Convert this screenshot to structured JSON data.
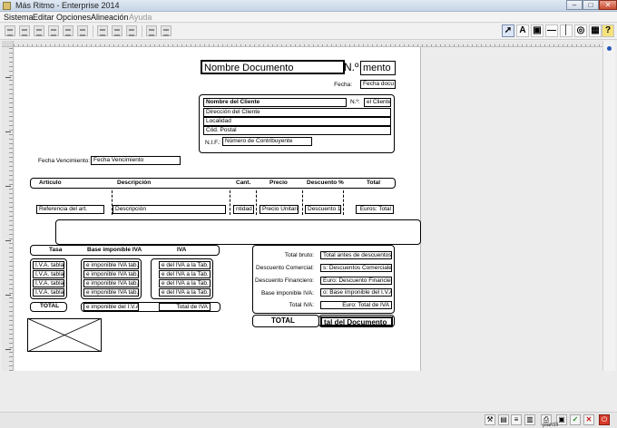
{
  "window": {
    "title": "Más Ritmo - Enterprise 2014"
  },
  "menu": {
    "items": [
      "Sistema",
      "Editar",
      "Opciones",
      "Alineación",
      "Ayuda"
    ]
  },
  "tools": {
    "text": "A"
  },
  "header": {
    "doc_name": "Nombre Documento",
    "num_label": "N.º",
    "num_value": "mento",
    "fecha_label": "Fecha:",
    "fecha_value": "Fecha docu"
  },
  "client": {
    "name": "Nombre del Cliente",
    "num_label": "N.º:",
    "num_value": "el Cliente",
    "address": "Dirección del Cliente",
    "city": "Localidad",
    "postal": "Cód. Postal",
    "nif_label": "N.I.F.:",
    "nif_value": "Número de Contribuyente"
  },
  "due": {
    "label": "Fecha Vencimiento:",
    "value": "Fecha Vencimiento"
  },
  "columns": {
    "articulo": "Artículo",
    "descripcion": "Descripción",
    "cant": "Cant.",
    "precio": "Precio",
    "descuento": "Descuento %",
    "total": "Total"
  },
  "row": {
    "ref": "Referencia del art.",
    "desc": "Descripción",
    "qty": "ntidad",
    "price": "Precio Unitario",
    "disc": "Descuento 1",
    "total": "Euros: Total"
  },
  "tax": {
    "tasa_header": "Tasa",
    "base_header": "Base imponible IVA",
    "iva_header": "IVA",
    "tasas": [
      "I.V.A. tabla 1",
      "I.V.A. tabla 2",
      "I.V.A. tabla 3",
      "I.V.A. tabla 4"
    ],
    "bases": [
      "e imponible IVA tab. 1",
      "e imponible IVA tab. 2",
      "e imponible IVA tab. 3",
      "e imponible IVA tab. 4"
    ],
    "ivas": [
      "e del IVA a la Tab. 1",
      "e del IVA a la Tab. 2",
      "e del IVA a la Tab. 3",
      "e del IVA a la Tab. 4"
    ],
    "total_label": "TOTAL",
    "total_base": "e imponible del I.V.A.",
    "total_iva": "Total de IVA"
  },
  "totals": {
    "labels": [
      "Total bruto:",
      "Descuento Comercial:",
      "Descuento Financiero:",
      "Base imponible IVA:",
      "Total IVA:"
    ],
    "values": [
      "Total antes de descuentos",
      "s: Descuentos Comerciales",
      "Euro: Descuento Financiero",
      "o: Base imponible del I.V.A.",
      "Euro: Total de IVA"
    ],
    "grand_label": "TOTAL",
    "grand_value": "tal del Documento"
  },
  "status": {
    "tooltip": "plantill"
  }
}
